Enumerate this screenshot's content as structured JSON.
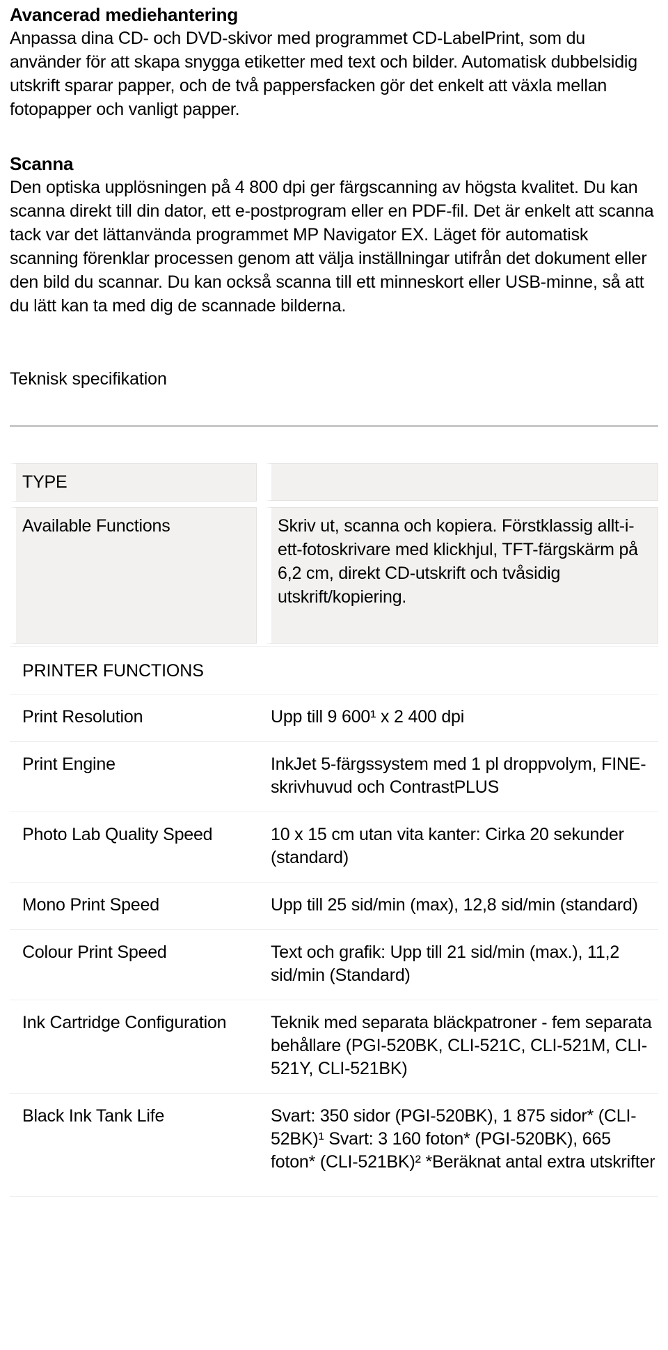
{
  "document": {
    "sections": [
      {
        "heading": "Avancerad mediehantering",
        "body": "Anpassa dina CD- och DVD-skivor med programmet CD-LabelPrint, som du använder för att skapa snygga etiketter med text och bilder. Automatisk dubbelsidig utskrift sparar papper, och de två pappersfacken gör det enkelt att växla mellan fotopapper och vanligt papper."
      },
      {
        "heading": "Scanna",
        "body": "Den optiska upplösningen på 4 800 dpi ger färgscanning av högsta kvalitet. Du kan scanna direkt till din dator, ett e-postprogram eller en PDF-fil. Det är enkelt att scanna tack var det lättanvända programmet MP Navigator EX. Läget för automatisk scanning förenklar processen genom att välja inställningar utifrån det dokument eller den bild du scannar. Du kan också scanna till ett minneskort eller USB-minne, så att du lätt kan ta med dig de scannade bilderna."
      }
    ],
    "spec_heading": "Teknisk specifikation",
    "spec_table": {
      "rows": [
        {
          "style": "boxed",
          "label": "TYPE",
          "value": ""
        },
        {
          "style": "boxed",
          "label": "Available Functions",
          "value": "Skriv ut, scanna och kopiera. Förstklassig allt-i-ett-fotoskrivare med klickhjul, TFT-färgskärm på 6,2 cm, direkt CD-utskrift och tvåsidig utskrift/kopiering."
        },
        {
          "style": "section",
          "label": "PRINTER FUNCTIONS",
          "value": ""
        },
        {
          "style": "plain",
          "label": "Print Resolution",
          "value": "Upp till 9 600¹ x 2 400 dpi"
        },
        {
          "style": "plain",
          "label": "Print Engine",
          "value": "InkJet 5-färgssystem med 1 pl droppvolym, FINE-skrivhuvud och ContrastPLUS"
        },
        {
          "style": "plain",
          "label": "Photo Lab Quality Speed",
          "value": "10 x 15 cm utan vita kanter: Cirka 20 sekunder (standard)"
        },
        {
          "style": "plain",
          "label": "Mono Print Speed",
          "value": "Upp till 25 sid/min (max), 12,8 sid/min (standard)"
        },
        {
          "style": "plain",
          "label": "Colour Print Speed",
          "value": "Text och grafik: Upp till 21 sid/min (max.), 11,2 sid/min (Standard)"
        },
        {
          "style": "plain",
          "label": "Ink Cartridge Configuration",
          "value": "Teknik med separata bläckpatroner - fem separata behållare (PGI-520BK, CLI-521C, CLI-521M, CLI-521Y, CLI-521BK)"
        },
        {
          "style": "plain",
          "label": "Black Ink Tank Life",
          "value": "Svart: 350 sidor (PGI-520BK), 1 875 sidor* (CLI-52BK)¹ Svart: 3 160 foton* (PGI-520BK), 665 foton* (CLI-521BK)² *Beräknat antal extra utskrifter"
        }
      ]
    }
  }
}
